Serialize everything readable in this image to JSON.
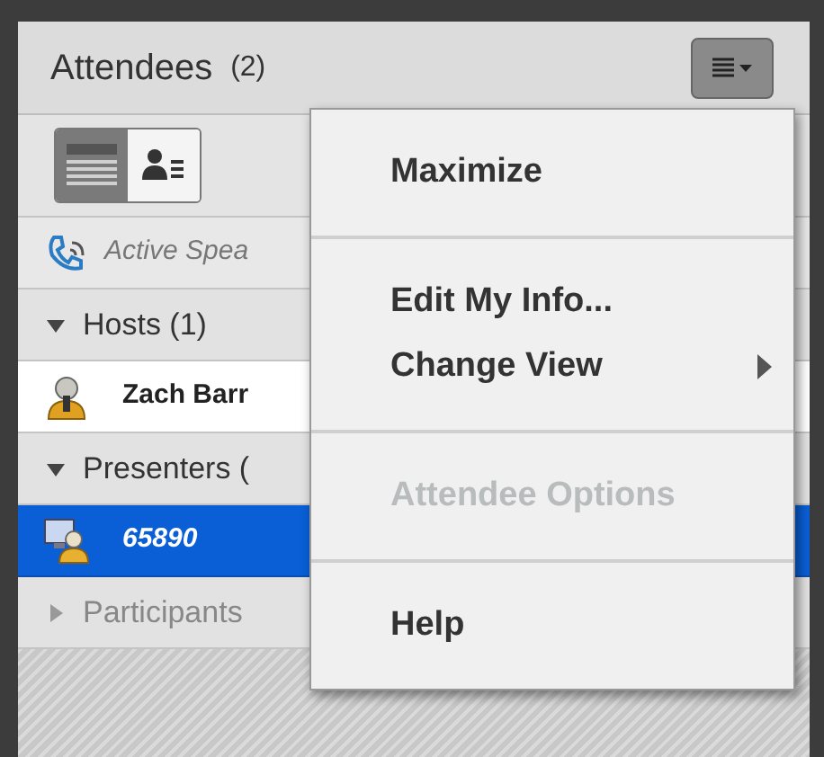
{
  "panel": {
    "title": "Attendees",
    "count": "(2)"
  },
  "view_toggle": [
    {
      "kind": "list",
      "selected": true
    },
    {
      "kind": "card",
      "selected": false
    }
  ],
  "active_speaker": {
    "label": "Active Spea"
  },
  "groups": [
    {
      "label": "Hosts (1)",
      "expanded": true,
      "attendees": [
        {
          "name": "Zach Barr",
          "kind": "host",
          "selected": false
        }
      ]
    },
    {
      "label": "Presenters (",
      "expanded": true,
      "attendees": [
        {
          "name": "65890",
          "kind": "presenter",
          "selected": true
        }
      ]
    },
    {
      "label": "Participants",
      "expanded": false
    }
  ],
  "menu": {
    "sections": [
      [
        {
          "label": "Maximize",
          "disabled": false,
          "submenu": false
        }
      ],
      [
        {
          "label": "Edit My Info...",
          "disabled": false,
          "submenu": false
        },
        {
          "label": "Change View",
          "disabled": false,
          "submenu": true
        }
      ],
      [
        {
          "label": "Attendee Options",
          "disabled": true,
          "submenu": false
        }
      ],
      [
        {
          "label": "Help",
          "disabled": false,
          "submenu": false
        }
      ]
    ]
  }
}
